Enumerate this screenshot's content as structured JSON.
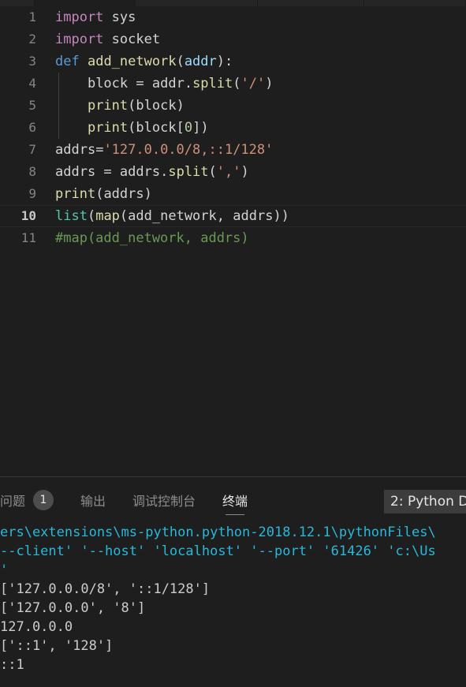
{
  "window": {
    "theme_background": "#1e1e1e",
    "tabstrip_background": "#252526"
  },
  "editor": {
    "language": "python",
    "current_line": 10,
    "lines": [
      {
        "n": "1",
        "text": "import sys"
      },
      {
        "n": "2",
        "text": "import socket"
      },
      {
        "n": "3",
        "text": "def add_network(addr):"
      },
      {
        "n": "4",
        "text": "    block = addr.split('/')"
      },
      {
        "n": "5",
        "text": "    print(block)"
      },
      {
        "n": "6",
        "text": "    print(block[0])"
      },
      {
        "n": "7",
        "text": "addrs='127.0.0.0/8,::1/128'"
      },
      {
        "n": "8",
        "text": "addrs = addrs.split(',')"
      },
      {
        "n": "9",
        "text": "print(addrs)"
      },
      {
        "n": "10",
        "text": "list(map(add_network, addrs))"
      },
      {
        "n": "11",
        "text": "#map(add_network, addrs)"
      }
    ],
    "tokens": {
      "l1": {
        "kw": "import",
        "rest": " sys"
      },
      "l2": {
        "kw": "import",
        "rest": " socket"
      },
      "l3": {
        "kw": "def",
        "sp": " ",
        "fn": "add_network",
        "p1": "(",
        "param": "addr",
        "p2": "):"
      },
      "l4": {
        "indent": "    ",
        "var": "block ",
        "eq": "= ",
        "obj": "addr",
        "dot": ".",
        "meth": "split",
        "p1": "(",
        "str": "'/'",
        "p2": ")"
      },
      "l5": {
        "indent": "    ",
        "fn": "print",
        "p1": "(",
        "var": "block",
        "p2": ")"
      },
      "l6": {
        "indent": "    ",
        "fn": "print",
        "p1": "(",
        "var": "block",
        "br1": "[",
        "num": "0",
        "br2": "]",
        "p2": ")"
      },
      "l7": {
        "var": "addrs",
        "eq": "=",
        "str": "'127.0.0.0/8,::1/128'"
      },
      "l8": {
        "var": "addrs ",
        "eq": "= ",
        "obj": "addrs",
        "dot": ".",
        "meth": "split",
        "p1": "(",
        "str": "','",
        "p2": ")"
      },
      "l9": {
        "fn": "print",
        "p1": "(",
        "var": "addrs",
        "p2": ")"
      },
      "l10": {
        "builtin": "list",
        "p1": "(",
        "fn": "map",
        "p2": "(",
        "arg1": "add_network",
        "comma": ", ",
        "arg2": "addrs",
        "p3": "))"
      },
      "l11": {
        "comment": "#map(add_network, addrs)"
      }
    },
    "colors": {
      "keyword": "#c586c0",
      "def_keyword": "#569cd6",
      "function": "#dcdcaa",
      "parameter": "#9cdcfe",
      "string": "#ce9178",
      "number": "#b5cea8",
      "comment": "#6a9955",
      "builtin": "#4ec9b0",
      "plain": "#d4d4d4",
      "line_number": "#858585",
      "line_number_active": "#c6c6c6"
    }
  },
  "panel": {
    "tabs": [
      {
        "label": "问题",
        "badge": "1",
        "active": false
      },
      {
        "label": "输出",
        "badge": "",
        "active": false
      },
      {
        "label": "调试控制台",
        "badge": "",
        "active": false
      },
      {
        "label": "终端",
        "badge": "",
        "active": true
      }
    ],
    "terminal_selector": "2: Python D",
    "terminal_lines": [
      {
        "text": "ers\\extensions\\ms-python.python-2018.12.1\\pythonFiles\\",
        "color": "cyan"
      },
      {
        "text": "--client' '--host' 'localhost' '--port' '61426' 'c:\\Us",
        "color": "cyan"
      },
      {
        "text": "'",
        "color": "cyan"
      },
      {
        "text": "['127.0.0.0/8', '::1/128']",
        "color": "white"
      },
      {
        "text": "['127.0.0.0', '8']",
        "color": "white"
      },
      {
        "text": "127.0.0.0",
        "color": "white"
      },
      {
        "text": "['::1', '128']",
        "color": "white"
      },
      {
        "text": "::1",
        "color": "white"
      }
    ]
  }
}
